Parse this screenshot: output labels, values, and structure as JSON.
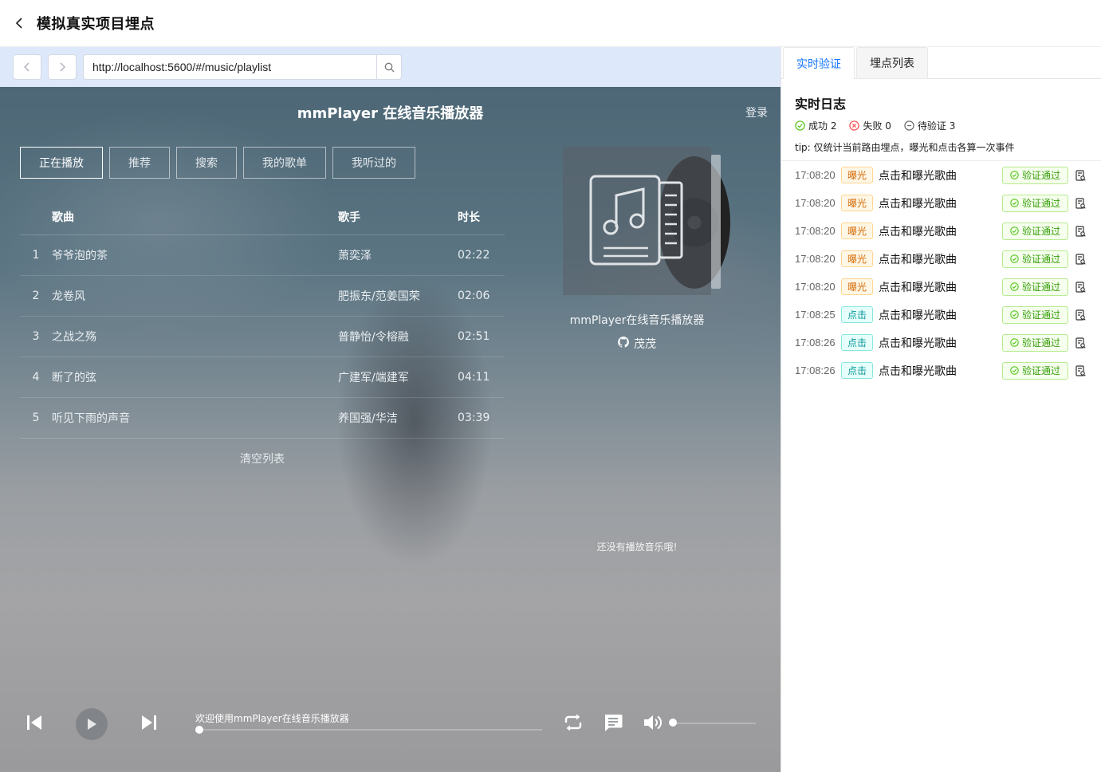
{
  "header": {
    "title": "模拟真实项目埋点"
  },
  "browser": {
    "url": "http://localhost:5600/#/music/playlist"
  },
  "player": {
    "title": "mmPlayer 在线音乐播放器",
    "login": "登录",
    "tabs": [
      "正在播放",
      "推荐",
      "搜索",
      "我的歌单",
      "我听过的"
    ],
    "columns": {
      "song": "歌曲",
      "singer": "歌手",
      "duration": "时长"
    },
    "songs": [
      {
        "idx": "1",
        "name": "爷爷泡的茶",
        "singer": "萧奕泽",
        "duration": "02:22"
      },
      {
        "idx": "2",
        "name": "龙卷风",
        "singer": "肥振东/范姜国荣",
        "duration": "02:06"
      },
      {
        "idx": "3",
        "name": "之战之殇",
        "singer": "普静怡/令榕融",
        "duration": "02:51"
      },
      {
        "idx": "4",
        "name": "断了的弦",
        "singer": "广建军/端建军",
        "duration": "04:11"
      },
      {
        "idx": "5",
        "name": "听见下雨的声音",
        "singer": "养国强/华洁",
        "duration": "03:39"
      }
    ],
    "clear_list": "清空列表",
    "album_name": "mmPlayer在线音乐播放器",
    "author": "茂茂",
    "no_music": "还没有播放音乐哦!",
    "progress_text": "欢迎使用mmPlayer在线音乐播放器",
    "progress": 0,
    "volume": 0
  },
  "panel": {
    "tabs": [
      "实时验证",
      "埋点列表"
    ],
    "log_title": "实时日志",
    "stats": {
      "success": "成功 2",
      "fail": "失败 0",
      "pending": "待验证 3"
    },
    "tip": "tip: 仅统计当前路由埋点，曝光和点击各算一次事件",
    "verified_label": "验证通过",
    "logs": [
      {
        "time": "17:08:20",
        "type": "曝光",
        "kind": "expose",
        "event": "点击和曝光歌曲"
      },
      {
        "time": "17:08:20",
        "type": "曝光",
        "kind": "expose",
        "event": "点击和曝光歌曲"
      },
      {
        "time": "17:08:20",
        "type": "曝光",
        "kind": "expose",
        "event": "点击和曝光歌曲"
      },
      {
        "time": "17:08:20",
        "type": "曝光",
        "kind": "expose",
        "event": "点击和曝光歌曲"
      },
      {
        "time": "17:08:20",
        "type": "曝光",
        "kind": "expose",
        "event": "点击和曝光歌曲"
      },
      {
        "time": "17:08:25",
        "type": "点击",
        "kind": "click",
        "event": "点击和曝光歌曲"
      },
      {
        "time": "17:08:26",
        "type": "点击",
        "kind": "click",
        "event": "点击和曝光歌曲"
      },
      {
        "time": "17:08:26",
        "type": "点击",
        "kind": "click",
        "event": "点击和曝光歌曲"
      }
    ]
  },
  "colors": {
    "accent": "#1677ff",
    "success": "#52c41a",
    "error": "#ff4d4f",
    "expose": "#d46b08",
    "click": "#08979c"
  }
}
